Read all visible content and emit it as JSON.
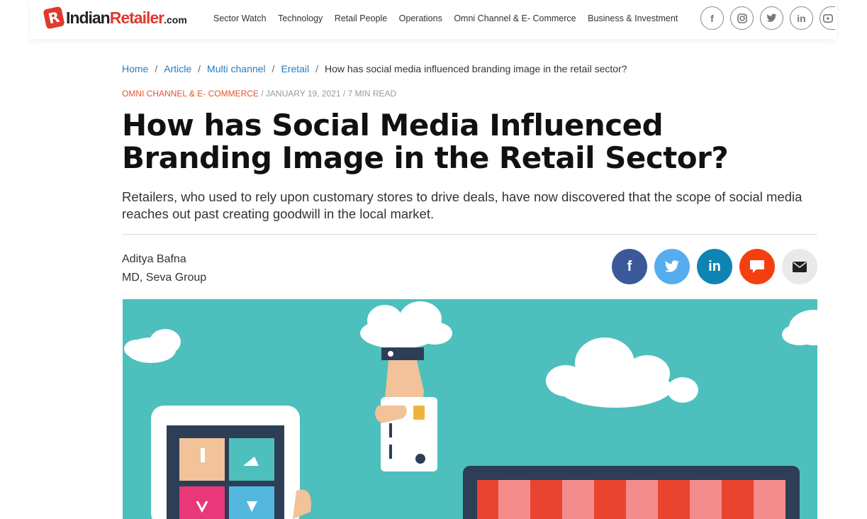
{
  "header": {
    "logo": {
      "part1": "Indian",
      "part2": "Retailer",
      "part3": ".com",
      "mark": "R"
    },
    "nav": [
      "Sector Watch",
      "Technology",
      "Retail People",
      "Operations",
      "Omni Channel & E- Commerce",
      "Business & Investment"
    ],
    "social_icons": [
      "facebook-icon",
      "instagram-icon",
      "twitter-icon",
      "linkedin-icon",
      "youtube-icon"
    ]
  },
  "breadcrumb": {
    "items": [
      "Home",
      "Article",
      "Multi channel",
      "Eretail"
    ],
    "current": "How has social media influenced branding image in the retail sector?",
    "separator": "/"
  },
  "meta": {
    "category": "OMNI CHANNEL & E- COMMERCE",
    "date": "/ JANUARY 19, 2021 / 7 MIN READ"
  },
  "article": {
    "title": "How has Social Media Influenced Branding Image in the Retail Sector?",
    "summary": "Retailers, who used to rely upon customary stores to drive deals, have now discovered that the scope of social media reaches out past creating goodwill in the local market.",
    "author_name": "Aditya Bafna",
    "author_role": "MD, Seva Group"
  },
  "share": {
    "buttons": [
      "facebook-icon",
      "twitter-icon",
      "linkedin-icon",
      "comment-icon",
      "email-icon"
    ]
  },
  "colors": {
    "brand": "#e03a2f",
    "link": "#2a7bbf",
    "category": "#e8512b",
    "hero_bg": "#4dbfbc"
  }
}
